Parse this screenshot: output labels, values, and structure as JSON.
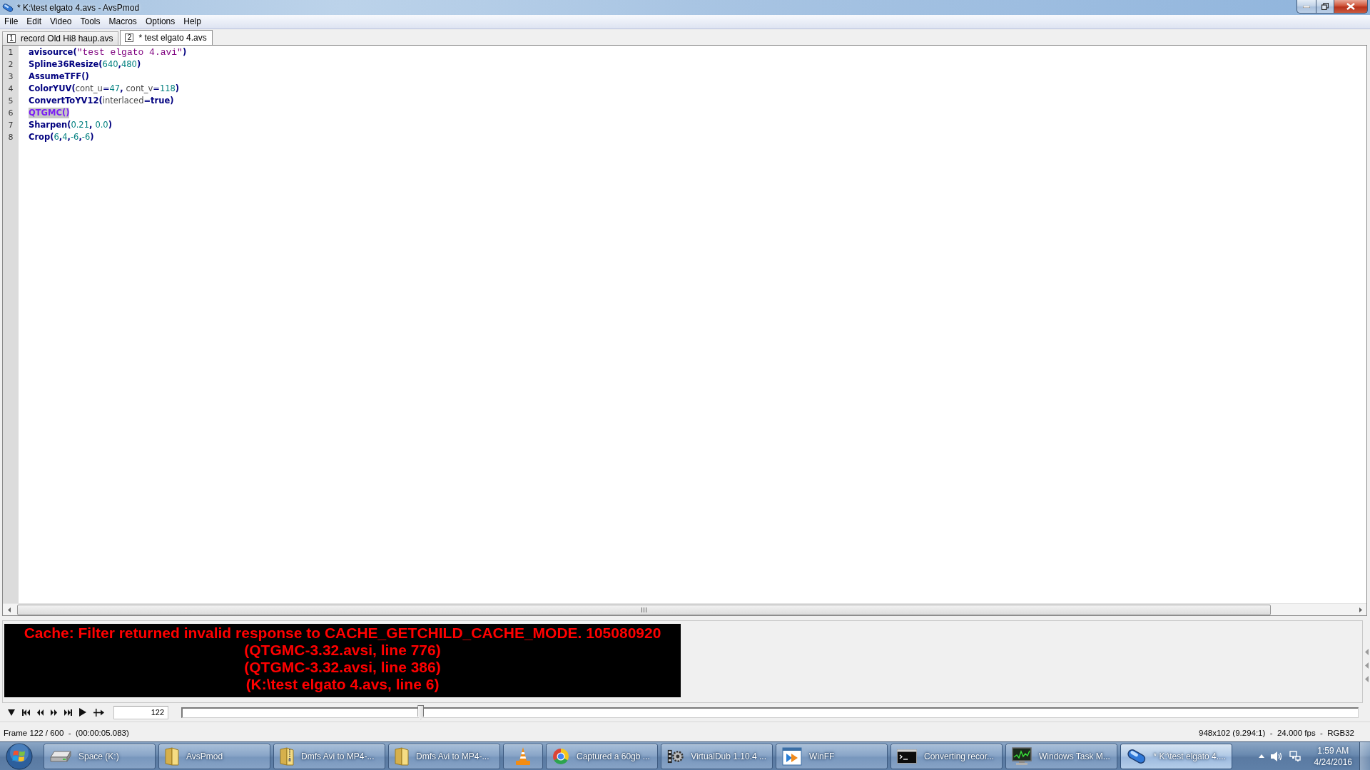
{
  "window": {
    "title": "* K:\\test elgato 4.avs - AvsPmod"
  },
  "menu": [
    "File",
    "Edit",
    "Video",
    "Tools",
    "Macros",
    "Options",
    "Help"
  ],
  "tabs": [
    {
      "index": "1",
      "label": "record Old Hi8 haup.avs",
      "selected": false
    },
    {
      "index": "2",
      "label": "* test elgato 4.avs",
      "selected": true
    }
  ],
  "editor": {
    "lines": [
      {
        "number": "1",
        "selected": false,
        "tokens": [
          {
            "kind": "function",
            "text": "avisource"
          },
          {
            "kind": "punct",
            "text": "("
          },
          {
            "kind": "string",
            "text": "\"test elgato 4.avi\""
          },
          {
            "kind": "punct",
            "text": ")"
          }
        ]
      },
      {
        "number": "2",
        "selected": false,
        "tokens": [
          {
            "kind": "function",
            "text": "Spline36Resize"
          },
          {
            "kind": "punct",
            "text": "("
          },
          {
            "kind": "number",
            "text": "640"
          },
          {
            "kind": "punct",
            "text": ","
          },
          {
            "kind": "number",
            "text": "480"
          },
          {
            "kind": "punct",
            "text": ")"
          }
        ]
      },
      {
        "number": "3",
        "selected": false,
        "tokens": [
          {
            "kind": "function",
            "text": "AssumeTFF"
          },
          {
            "kind": "punct",
            "text": "()"
          }
        ]
      },
      {
        "number": "4",
        "selected": false,
        "tokens": [
          {
            "kind": "function",
            "text": "ColorYUV"
          },
          {
            "kind": "punct",
            "text": "("
          },
          {
            "kind": "param",
            "text": "cont_u"
          },
          {
            "kind": "operator",
            "text": "="
          },
          {
            "kind": "number",
            "text": "47"
          },
          {
            "kind": "punct",
            "text": ", "
          },
          {
            "kind": "param",
            "text": "cont_v"
          },
          {
            "kind": "operator",
            "text": "="
          },
          {
            "kind": "number",
            "text": "118"
          },
          {
            "kind": "punct",
            "text": ")"
          }
        ]
      },
      {
        "number": "5",
        "selected": false,
        "tokens": [
          {
            "kind": "function",
            "text": "ConvertToYV12"
          },
          {
            "kind": "punct",
            "text": "("
          },
          {
            "kind": "param",
            "text": "interlaced"
          },
          {
            "kind": "operator",
            "text": "="
          },
          {
            "kind": "keyword",
            "text": "true"
          },
          {
            "kind": "punct",
            "text": ")"
          }
        ]
      },
      {
        "number": "6",
        "selected": true,
        "tokens": [
          {
            "kind": "plugin",
            "text": "QTGMC()"
          }
        ]
      },
      {
        "number": "7",
        "selected": false,
        "tokens": [
          {
            "kind": "function",
            "text": "Sharpen"
          },
          {
            "kind": "punct",
            "text": "("
          },
          {
            "kind": "number",
            "text": "0.21"
          },
          {
            "kind": "punct",
            "text": ", "
          },
          {
            "kind": "number",
            "text": "0.0"
          },
          {
            "kind": "punct",
            "text": ")"
          }
        ]
      },
      {
        "number": "8",
        "selected": false,
        "tokens": [
          {
            "kind": "function",
            "text": "Crop"
          },
          {
            "kind": "punct",
            "text": "("
          },
          {
            "kind": "number",
            "text": "6"
          },
          {
            "kind": "punct",
            "text": ","
          },
          {
            "kind": "number",
            "text": "4"
          },
          {
            "kind": "punct",
            "text": ","
          },
          {
            "kind": "number",
            "text": "-6"
          },
          {
            "kind": "punct",
            "text": ","
          },
          {
            "kind": "number",
            "text": "-6"
          },
          {
            "kind": "punct",
            "text": ")"
          }
        ]
      }
    ]
  },
  "error_panel": {
    "lines": [
      "Cache: Filter returned invalid response to CACHE_GETCHILD_CACHE_MODE. 105080920",
      "(QTGMC-3.32.avsi, line 776)",
      "(QTGMC-3.32.avsi, line 386)",
      "(K:\\test elgato 4.avs, line 6)"
    ]
  },
  "controls": {
    "frame": "122",
    "slider": {
      "level": 0.203
    }
  },
  "status_bar": {
    "left": "Frame 122 / 600  -  (00:00:05.083)",
    "right": "948x102 (9.294:1)  -  24.000 fps  -  RGB32"
  },
  "taskbar": {
    "items": [
      {
        "kind": "drive",
        "label": "Space (K:)",
        "selected": false
      },
      {
        "kind": "folder",
        "label": "AvsPmod",
        "selected": false
      },
      {
        "kind": "zip-folder",
        "label": "Dmfs Avi to MP4-...",
        "selected": false
      },
      {
        "kind": "folder",
        "label": "Dmfs Avi to MP4-...",
        "selected": false
      },
      {
        "kind": "cone",
        "selected": false
      },
      {
        "kind": "circle-logo",
        "label": "Captured a 60gb ...",
        "selected": false
      },
      {
        "kind": "film-gear",
        "label": "VirtualDub 1.10.4 ...",
        "selected": false
      },
      {
        "kind": "window-arrow",
        "label": "WinFF",
        "selected": false
      },
      {
        "kind": "console",
        "label": "Converting recor...",
        "selected": false
      },
      {
        "kind": "monitor-chart",
        "label": "Windows Task M...",
        "selected": false
      },
      {
        "kind": "capsule",
        "label": "* K:\\test elgato 4....",
        "selected": true
      }
    ],
    "clock": {
      "time": "1:59 AM",
      "date": "4/24/2016"
    }
  }
}
